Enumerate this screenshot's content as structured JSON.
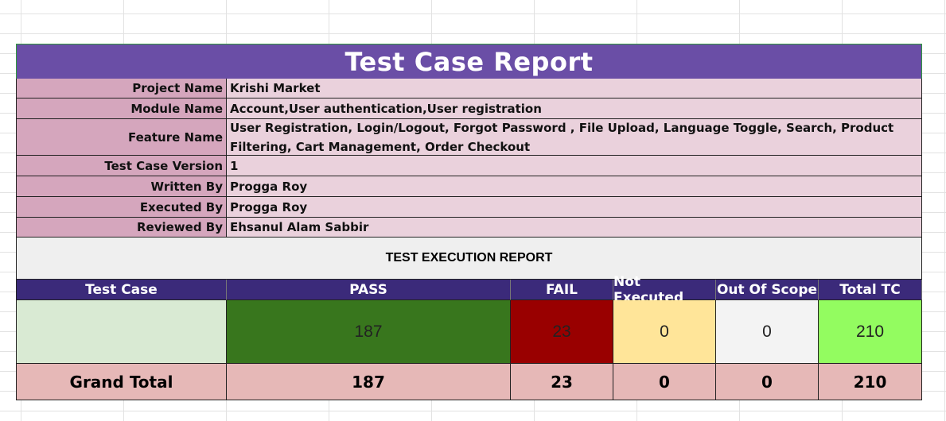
{
  "report": {
    "title": "Test Case Report",
    "info": [
      {
        "label": "Project Name",
        "value": "Krishi Market"
      },
      {
        "label": "Module Name",
        "value": "Account,User authentication,User registration"
      },
      {
        "label": "Feature Name",
        "value": "User Registration, Login/Logout, Forgot Password , File Upload, Language Toggle, Search, Product Filtering, Cart Management, Order Checkout"
      },
      {
        "label": "Test Case Version",
        "value": "1"
      },
      {
        "label": "Written By",
        "value": "Progga Roy"
      },
      {
        "label": "Executed By",
        "value": "Progga Roy"
      },
      {
        "label": "Reviewed By",
        "value": "Ehsanul Alam Sabbir"
      }
    ],
    "section_title": "TEST EXECUTION REPORT",
    "columns": [
      "Test Case",
      "PASS",
      "FAIL",
      "Not Executed",
      "Out Of Scope",
      "Total TC"
    ],
    "values": [
      "",
      "187",
      "23",
      "0",
      "0",
      "210"
    ],
    "grand_total": {
      "label": "Grand Total",
      "values": [
        "187",
        "23",
        "0",
        "0",
        "210"
      ]
    }
  },
  "colors": {
    "title_bg": "#6a4ea6",
    "label_bg": "#d5a6bd",
    "value_bg": "#ead1dc",
    "header_bg": "#3b2a7a",
    "test_case_cell": "#d9ead3",
    "pass_cell": "#38761d",
    "fail_cell": "#990000",
    "not_executed_cell": "#ffe599",
    "out_of_scope_cell": "#f3f3f3",
    "total_cell": "#93fc60",
    "grand_total_bg": "#e6b8b7"
  }
}
